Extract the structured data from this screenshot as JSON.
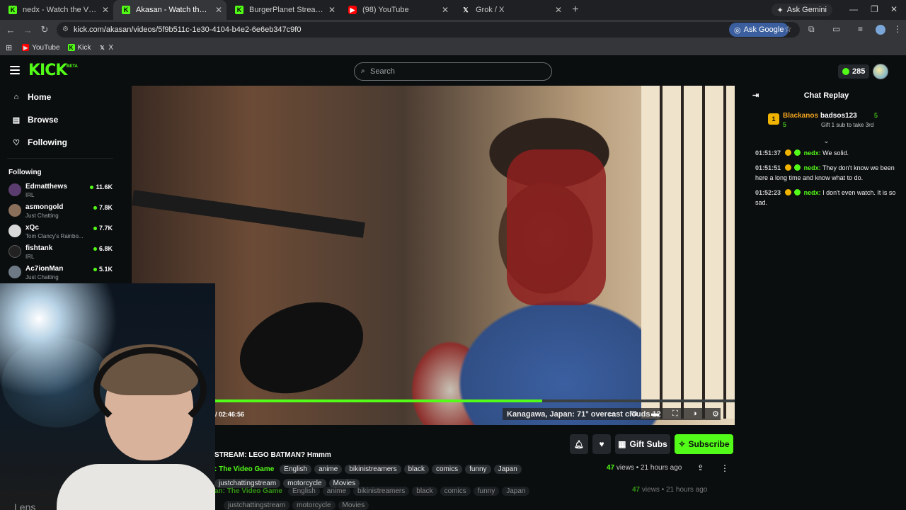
{
  "browser": {
    "tabs": [
      {
        "title": "nedx - Watch the VOD on Kick",
        "icon": "kick",
        "active": false
      },
      {
        "title": "Akasan - Watch the VOD on Kick",
        "icon": "kick",
        "active": true
      },
      {
        "title": "BurgerPlanet Stream - Watch Li",
        "icon": "kick",
        "active": false
      },
      {
        "title": "(98) YouTube",
        "icon": "youtube",
        "active": false
      },
      {
        "title": "Grok / X",
        "icon": "x",
        "active": false
      }
    ],
    "ask_gemini": "Ask Gemini",
    "url": "kick.com/akasan/videos/5f9b511c-1e30-4104-b4e2-6e6eb347c9f0",
    "ask_google": "Ask Google",
    "bookmarks": [
      "YouTube",
      "Kick",
      "X"
    ]
  },
  "header": {
    "logo": "KICK",
    "beta": "BETA",
    "search_placeholder": "Search",
    "points": "285"
  },
  "sidebar": {
    "nav": [
      {
        "label": "Home",
        "icon": "home-icon"
      },
      {
        "label": "Browse",
        "icon": "browse-icon"
      },
      {
        "label": "Following",
        "icon": "heart-icon"
      }
    ],
    "following_heading": "Following",
    "following": [
      {
        "name": "Edmatthews",
        "category": "IRL",
        "viewers": "11.6K",
        "color": "#5a3d6e"
      },
      {
        "name": "asmongold",
        "category": "Just Chatting",
        "viewers": "7.8K",
        "color": "#8a6f5a"
      },
      {
        "name": "xQc",
        "category": "Tom Clancy's Rainbo...",
        "viewers": "7.7K",
        "color": "#d9d9d9"
      },
      {
        "name": "fishtank",
        "category": "IRL",
        "viewers": "6.8K",
        "color": "#222222"
      },
      {
        "name": "Ac7ionMan",
        "category": "Just Chatting",
        "viewers": "5.1K",
        "color": "#6d7a86"
      }
    ]
  },
  "video": {
    "timecode": "/ 02:46:56",
    "progress": 0.63,
    "weather_overlay": "Kanagawa, Japan: 71°  overcast clouds 12"
  },
  "webcam": {
    "overlay_text": "Lens"
  },
  "stream": {
    "title": "STREAM: LEGO BATMAN? Hmmm",
    "category": ": The Video Game",
    "tags_row1": [
      "English",
      "anime",
      "bikinistreamers",
      "black",
      "comics",
      "funny",
      "Japan"
    ],
    "tags_row2": [
      "justchattingstream",
      "motorcycle",
      "Movies"
    ],
    "views": "47",
    "views_label": "views",
    "time_ago": "21 hours ago",
    "gift_subs": "Gift Subs",
    "subscribe": "Subscribe",
    "ghost_category": "an: The Video Game"
  },
  "chat": {
    "title": "Chat Replay",
    "pinned": {
      "user1": "Blackanos",
      "user1_count": "5",
      "rank": "1",
      "user2": "badsos123",
      "user2_count": "5",
      "promo": "Gift 1 sub to take 3rd"
    },
    "messages": [
      {
        "time": "01:51:37",
        "user": "nedx",
        "text": "We solid."
      },
      {
        "time": "01:51:51",
        "user": "nedx",
        "text": "They don't know we been here a long time and know what to do."
      },
      {
        "time": "01:52:23",
        "user": "nedx",
        "text": "I don't even watch. It is so sad."
      }
    ]
  },
  "colors": {
    "kick_green": "#53fc18",
    "background": "#0b0e0f",
    "gold": "#f0b400"
  }
}
